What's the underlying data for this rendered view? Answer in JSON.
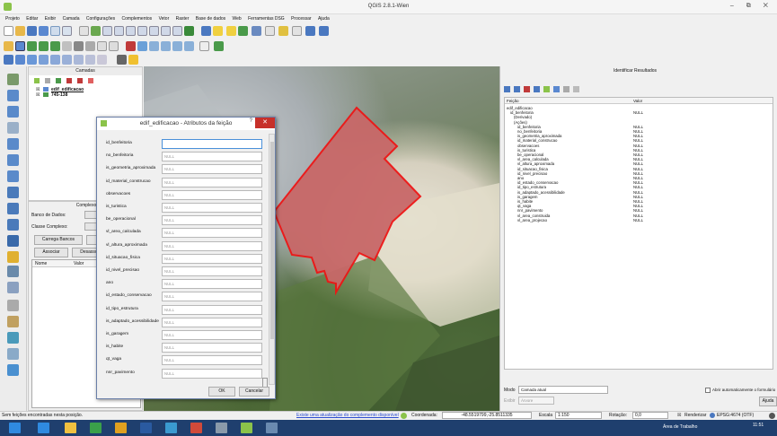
{
  "window": {
    "title": "QGIS 2.8.1-Wien",
    "controls": "– ⧉ ✕"
  },
  "menu": [
    "Projeto",
    "Editar",
    "Exibir",
    "Camada",
    "Configurações",
    "Complementos",
    "Vetor",
    "Raster",
    "Base de dados",
    "Web",
    "Ferramentas DSG",
    "Processar",
    "Ajuda"
  ],
  "layers_panel": {
    "title": "Camadas",
    "items": [
      {
        "label": "edif_edificacao"
      },
      {
        "label": "745-138"
      }
    ]
  },
  "complexo_panel": {
    "title": "Complexo",
    "db_label": "Banco de Dados:",
    "class_label": "Classe Complexo:",
    "load_button": "Carrega Bancos",
    "associate_button": "Associar",
    "disassociate_button": "Desassociar",
    "columns": [
      "Nome",
      "Valor"
    ]
  },
  "dialog": {
    "title": "edif_edificacao - Atributos da feição",
    "help": "?",
    "close": "✕",
    "ok": "OK",
    "cancel": "Cancelar",
    "fields": [
      {
        "label": "id_benfeitoria",
        "value": ""
      },
      {
        "label": "no_benfeitoria",
        "value": "NULL"
      },
      {
        "label": "is_geometria_aproximada",
        "value": "NULL"
      },
      {
        "label": "id_material_construcao",
        "value": "NULL"
      },
      {
        "label": "observacoes",
        "value": "NULL"
      },
      {
        "label": "is_turistica",
        "value": "NULL"
      },
      {
        "label": "be_operacional",
        "value": "NULL"
      },
      {
        "label": "vl_area_calculada",
        "value": "NULL"
      },
      {
        "label": "vl_altura_aproximada",
        "value": "NULL"
      },
      {
        "label": "id_situacao_fisica",
        "value": "NULL"
      },
      {
        "label": "id_nivel_precisao",
        "value": "NULL"
      },
      {
        "label": "ano",
        "value": "NULL"
      },
      {
        "label": "id_estado_conservacao",
        "value": "NULL"
      },
      {
        "label": "id_tipo_estrutura",
        "value": "NULL"
      },
      {
        "label": "is_adaptado_acessibilidade",
        "value": "NULL"
      },
      {
        "label": "is_garagem",
        "value": "NULL"
      },
      {
        "label": "is_habite",
        "value": "NULL"
      },
      {
        "label": "qt_vaga",
        "value": "NULL"
      },
      {
        "label": "nnr_pavimento",
        "value": "NULL"
      }
    ]
  },
  "results_panel": {
    "title": "Identificar Resultados",
    "col_feature": "Feição",
    "col_value": "Valor",
    "rows": [
      {
        "k": "edif_edificacao",
        "v": ""
      },
      {
        "k": "id_benfeitoria",
        "v": "NULL"
      },
      {
        "k": "(Derivado)",
        "v": ""
      },
      {
        "k": "(Ações)",
        "v": ""
      },
      {
        "k": "id_benfeitoria",
        "v": "NULL"
      },
      {
        "k": "no_benfeitoria",
        "v": "NULL"
      },
      {
        "k": "is_geometria_aproximada",
        "v": "NULL"
      },
      {
        "k": "id_material_construcao",
        "v": "NULL"
      },
      {
        "k": "observacoes",
        "v": "NULL"
      },
      {
        "k": "is_turistica",
        "v": "NULL"
      },
      {
        "k": "be_operacional",
        "v": "NULL"
      },
      {
        "k": "vl_area_calculada",
        "v": "NULL"
      },
      {
        "k": "vl_altura_aproximada",
        "v": "NULL"
      },
      {
        "k": "id_situacao_fisica",
        "v": "NULL"
      },
      {
        "k": "id_nivel_precisao",
        "v": "NULL"
      },
      {
        "k": "ano",
        "v": "NULL"
      },
      {
        "k": "id_estado_conservacao",
        "v": "NULL"
      },
      {
        "k": "id_tipo_estrutura",
        "v": "NULL"
      },
      {
        "k": "is_adaptado_acessibilidade",
        "v": "NULL"
      },
      {
        "k": "is_garagem",
        "v": "NULL"
      },
      {
        "k": "is_habite",
        "v": "NULL"
      },
      {
        "k": "qt_vaga",
        "v": "NULL"
      },
      {
        "k": "nnr_pavimento",
        "v": "NULL"
      },
      {
        "k": "vl_area_construida",
        "v": "NULL"
      },
      {
        "k": "vl_area_projecao",
        "v": "NULL"
      }
    ],
    "mode_label": "Modo",
    "mode_value": "Camada atual",
    "view_label": "Exibir",
    "view_value": "Árvore",
    "auto_open": "Abrir automaticamente o formulário",
    "help_button": "Ajuda"
  },
  "statusbar": {
    "left": "Sem feições encontradas nesta posição.",
    "update_link": "Existe uma atualização do complemento disponível",
    "coord_label": "Coordenada:",
    "coord_value": "-48.5519799,-25.8511335",
    "scale_label": "Escala",
    "scale_value": "1:150",
    "rotation_label": "Rotação:",
    "rotation_value": "0,0",
    "render_label": "Renderizar",
    "crs": "EPSG:4674 (OTF)"
  },
  "taskbar": {
    "desktop_label": "Área de Trabalho",
    "time": "11:51"
  }
}
